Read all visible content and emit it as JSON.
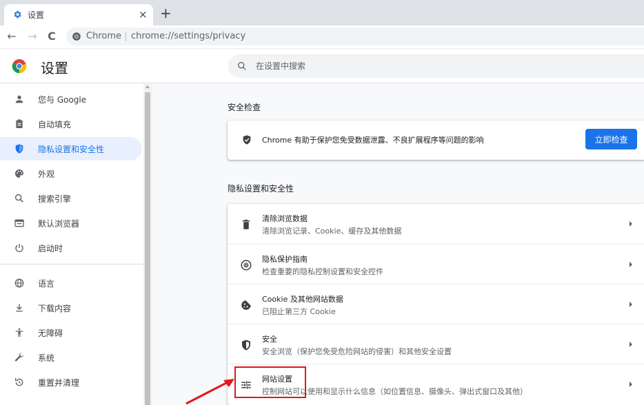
{
  "tab": {
    "title": "设置",
    "close_glyph": "×",
    "newtab_glyph": "+"
  },
  "toolbar": {
    "site_label": "Chrome",
    "url": "chrome://settings/privacy",
    "back_glyph": "←",
    "forward_glyph": "→",
    "reload_glyph": "C"
  },
  "app": {
    "title": "设置"
  },
  "search": {
    "placeholder": "在设置中搜索"
  },
  "sidebar": {
    "items": [
      {
        "label": "您与 Google",
        "icon": "person-icon"
      },
      {
        "label": "自动填充",
        "icon": "clipboard-icon"
      },
      {
        "label": "隐私设置和安全性",
        "icon": "shield-icon",
        "active": true
      },
      {
        "label": "外观",
        "icon": "palette-icon"
      },
      {
        "label": "搜索引擎",
        "icon": "search-icon"
      },
      {
        "label": "默认浏览器",
        "icon": "browser-icon"
      },
      {
        "label": "启动时",
        "icon": "power-icon"
      },
      {
        "label": "语言",
        "icon": "globe-icon"
      },
      {
        "label": "下载内容",
        "icon": "download-icon"
      },
      {
        "label": "无障碍",
        "icon": "accessibility-icon"
      },
      {
        "label": "系统",
        "icon": "wrench-icon"
      },
      {
        "label": "重置并清理",
        "icon": "reset-icon"
      }
    ]
  },
  "safety": {
    "section_title": "安全检查",
    "text": "Chrome 有助于保护您免受数据泄露、不良扩展程序等问题的影响",
    "button": "立即检查"
  },
  "privacy": {
    "section_title": "隐私设置和安全性",
    "rows": [
      {
        "title": "清除浏览数据",
        "subtitle": "清除浏览记录、Cookie、缓存及其他数据",
        "icon": "trash-icon"
      },
      {
        "title": "隐私保护指南",
        "subtitle": "检查重要的隐私控制设置和安全控件",
        "icon": "compass-icon"
      },
      {
        "title": "Cookie 及其他网站数据",
        "subtitle": "已阻止第三方 Cookie",
        "icon": "cookie-icon"
      },
      {
        "title": "安全",
        "subtitle": "安全浏览（保护您免受危险网站的侵害）和其他安全设置",
        "icon": "security-shield-icon"
      },
      {
        "title": "网站设置",
        "subtitle": "控制网站可以使用和显示什么信息（如位置信息、摄像头、弹出式窗口及其他）",
        "icon": "sliders-icon"
      }
    ]
  },
  "colors": {
    "accent": "#1a73e8",
    "active_bg": "#e8f0fe",
    "highlight": "#e0161a"
  }
}
